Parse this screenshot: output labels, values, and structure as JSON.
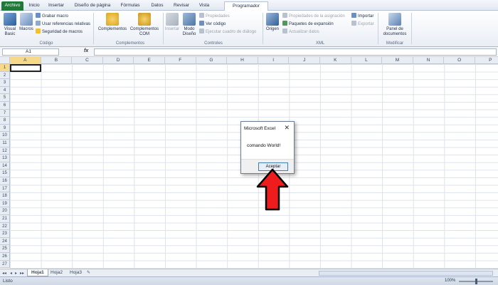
{
  "tabs": [
    "Archivo",
    "Inicio",
    "Insertar",
    "Diseño de página",
    "Fórmulas",
    "Datos",
    "Revisar",
    "Vista",
    "Programador"
  ],
  "ribbon": {
    "codigo": {
      "label": "Código",
      "visual_basic": "Visual Basic",
      "macros": "Macros",
      "grabar_macro": "Grabar macro",
      "usar_referencias": "Usar referencias relativas",
      "seguridad": "Seguridad de macros"
    },
    "complementos": {
      "label": "Complementos",
      "complementos": "Complementos",
      "complementos_com": "Complementos COM"
    },
    "controles": {
      "label": "Controles",
      "insertar": "Insertar",
      "modo_diseno": "Modo Diseño",
      "propiedades": "Propiedades",
      "ver_codigo": "Ver código",
      "ejecutar_cuadro": "Ejecutar cuadro de diálogo"
    },
    "xml": {
      "label": "XML",
      "origen": "Origen",
      "propiedades_asignacion": "Propiedades de la asignación",
      "paquetes": "Paquetes de expansión",
      "actualizar": "Actualizar datos",
      "importar": "Importar",
      "exportar": "Exportar"
    },
    "modificar": {
      "label": "Modificar",
      "panel": "Panel de documentos"
    }
  },
  "formula_bar": {
    "name_box": "A1",
    "fx": "fx",
    "value": ""
  },
  "columns": [
    "A",
    "B",
    "C",
    "D",
    "E",
    "F",
    "G",
    "H",
    "I",
    "J",
    "K",
    "L",
    "M",
    "N",
    "O",
    "P"
  ],
  "rows": [
    "1",
    "2",
    "3",
    "4",
    "5",
    "6",
    "7",
    "8",
    "9",
    "10",
    "11",
    "12",
    "13",
    "14",
    "15",
    "16",
    "17",
    "18",
    "19",
    "20",
    "21",
    "22",
    "23",
    "24",
    "25",
    "26",
    "27"
  ],
  "sheets": [
    "Hoja1",
    "Hoja2",
    "Hoja3"
  ],
  "status": {
    "text": "Listo",
    "zoom": "100%"
  },
  "dialog": {
    "title": "Microsoft Excel",
    "close": "✕",
    "message": "comando World!",
    "ok": "Aceptar"
  }
}
